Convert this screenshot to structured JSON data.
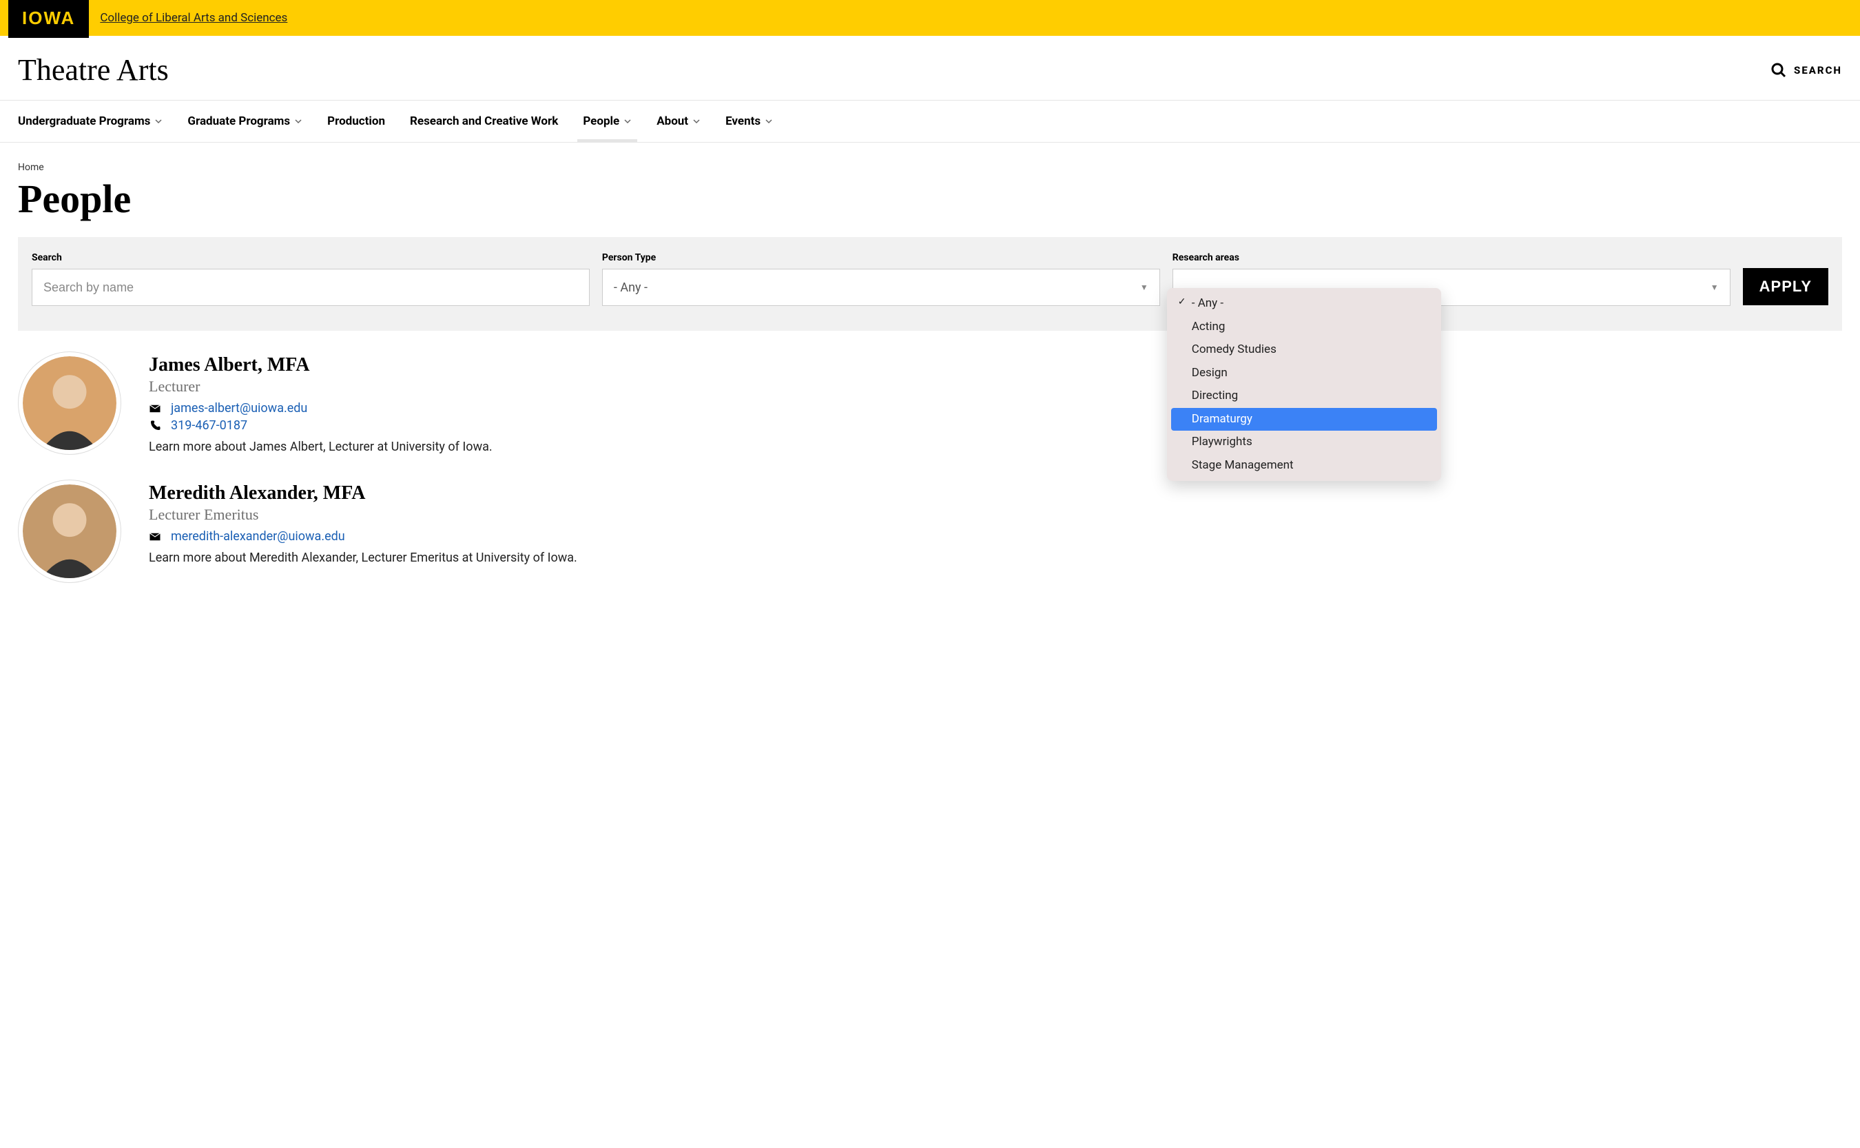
{
  "header": {
    "logo_text": "IOWA",
    "college_link": "College of Liberal Arts and Sciences",
    "site_title": "Theatre Arts",
    "search_label": "SEARCH"
  },
  "nav": {
    "items": [
      {
        "label": "Undergraduate Programs",
        "has_dropdown": true
      },
      {
        "label": "Graduate Programs",
        "has_dropdown": true
      },
      {
        "label": "Production",
        "has_dropdown": false
      },
      {
        "label": "Research and Creative Work",
        "has_dropdown": false
      },
      {
        "label": "People",
        "has_dropdown": true,
        "active": true
      },
      {
        "label": "About",
        "has_dropdown": true
      },
      {
        "label": "Events",
        "has_dropdown": true
      }
    ]
  },
  "breadcrumb": {
    "home": "Home"
  },
  "page": {
    "title": "People"
  },
  "filters": {
    "search": {
      "label": "Search",
      "placeholder": "Search by name"
    },
    "person_type": {
      "label": "Person Type",
      "selected": "- Any -"
    },
    "research_areas": {
      "label": "Research areas",
      "selected": "",
      "options": [
        {
          "label": "- Any -",
          "checked": true
        },
        {
          "label": "Acting"
        },
        {
          "label": "Comedy Studies"
        },
        {
          "label": "Design"
        },
        {
          "label": "Directing"
        },
        {
          "label": "Dramaturgy",
          "highlighted": true
        },
        {
          "label": "Playwrights"
        },
        {
          "label": "Stage Management"
        }
      ]
    },
    "apply_label": "APPLY"
  },
  "people": [
    {
      "name": "James Albert, MFA",
      "title": "Lecturer",
      "email": "james-albert@uiowa.edu",
      "phone": "319-467-0187",
      "blurb": "Learn more about James Albert, Lecturer at University of Iowa.",
      "avatar_bg": "#d9a36b"
    },
    {
      "name": "Meredith Alexander, MFA",
      "title": "Lecturer Emeritus",
      "email": "meredith-alexander@uiowa.edu",
      "phone": "",
      "blurb": "Learn more about Meredith Alexander, Lecturer Emeritus at University of Iowa.",
      "avatar_bg": "#c49a6c"
    }
  ]
}
